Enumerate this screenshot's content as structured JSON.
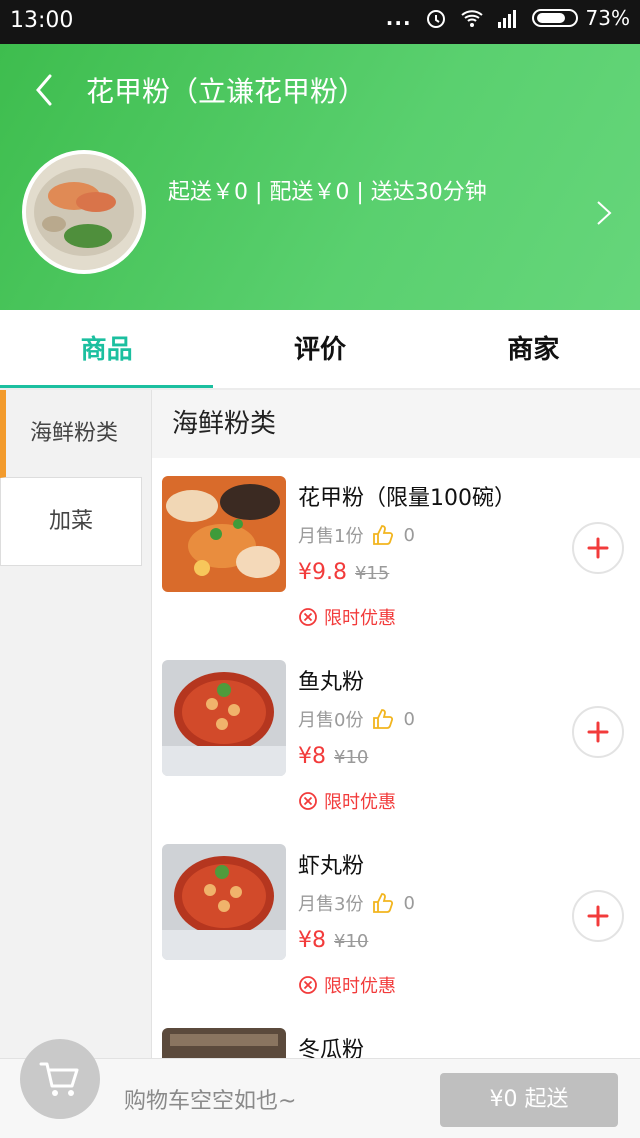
{
  "status_bar": {
    "time": "13:00",
    "dots": "...",
    "battery": "73%"
  },
  "header": {
    "title": "花甲粉（立谦花甲粉）",
    "shop_info": "起送￥0 | 配送￥0 | 送达30分钟"
  },
  "tabs": [
    {
      "label": "商品",
      "active": true
    },
    {
      "label": "评价",
      "active": false
    },
    {
      "label": "商家",
      "active": false
    }
  ],
  "categories": [
    {
      "label": "海鲜粉类",
      "active": true
    },
    {
      "label": "加菜",
      "active": false
    }
  ],
  "section_title": "海鲜粉类",
  "items": [
    {
      "name": "花甲粉（限量100碗）",
      "sold": "月售1份",
      "likes": "0",
      "price": "¥9.8",
      "orig": "¥15",
      "promo": "限时优惠"
    },
    {
      "name": "鱼丸粉",
      "sold": "月售0份",
      "likes": "0",
      "price": "¥8",
      "orig": "¥10",
      "promo": "限时优惠"
    },
    {
      "name": "虾丸粉",
      "sold": "月售3份",
      "likes": "0",
      "price": "¥8",
      "orig": "¥10",
      "promo": "限时优惠"
    },
    {
      "name": "冬瓜粉"
    }
  ],
  "cart": {
    "empty_text": "购物车空空如也~",
    "checkout_label": "¥0 起送"
  },
  "colors": {
    "header_green": "#4fc765",
    "accent_teal": "#1bbf9f",
    "price_red": "#f23b3b",
    "category_marker": "#f39b2d"
  },
  "icons": [
    "back-icon",
    "chevron-right-icon",
    "thumb-up-icon",
    "promo-icon",
    "plus-icon",
    "cart-icon",
    "wifi-icon",
    "signal-icon",
    "alarm-icon"
  ]
}
